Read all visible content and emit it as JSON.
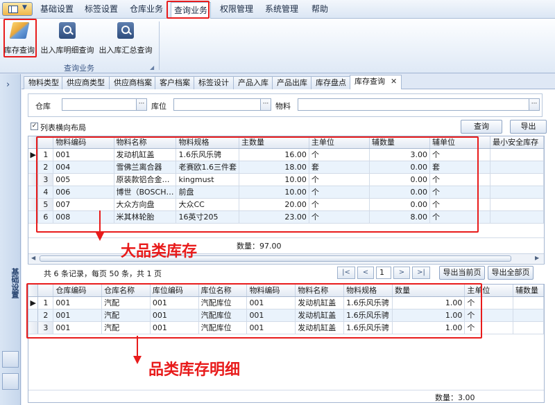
{
  "menu": {
    "items": [
      "基础设置",
      "标签设置",
      "仓库业务",
      "查询业务",
      "权限管理",
      "系统管理",
      "帮助"
    ],
    "active_index": 3
  },
  "ribbon": {
    "buttons": [
      "库存查询",
      "出入库明细查询",
      "出入库汇总查询"
    ],
    "group_label": "查询业务"
  },
  "left_nav": {
    "label": "基础设置"
  },
  "tabs": {
    "items": [
      "物料类型",
      "供应商类型",
      "供应商档案",
      "客户档案",
      "标签设计",
      "产品入库",
      "产品出库",
      "库存盘点",
      "库存查询"
    ],
    "active_index": 8,
    "close_glyph": "✕"
  },
  "filters": {
    "warehouse_label": "仓库",
    "warehouse_value": "",
    "location_label": "库位",
    "location_value": "",
    "material_label": "物料",
    "material_value": "",
    "dots": "···"
  },
  "options": {
    "horizontal_layout_label": "列表横向布局",
    "horizontal_layout_checked": true
  },
  "actions": {
    "query_label": "查询",
    "export_label": "导出"
  },
  "stock_grid": {
    "columns": [
      "物料编码",
      "物料名称",
      "物料规格",
      "主数量",
      "主单位",
      "辅数量",
      "辅单位",
      "最小安全库存"
    ],
    "rows": [
      [
        "1",
        "001",
        "发动机缸盖",
        "1.6乐风乐骋",
        "16.00",
        "个",
        "3.00",
        "个",
        ""
      ],
      [
        "2",
        "004",
        "雪佛兰离合器",
        "老赛欧1.6三件套",
        "18.00",
        "套",
        "0.00",
        "套",
        ""
      ],
      [
        "3",
        "005",
        "原装款铝合金…",
        "kingmust",
        "10.00",
        "个",
        "0.00",
        "个",
        ""
      ],
      [
        "4",
        "006",
        "博世（BOSCH…",
        "前盘",
        "10.00",
        "个",
        "0.00",
        "个",
        ""
      ],
      [
        "5",
        "007",
        "大众方向盘",
        "大众CC",
        "20.00",
        "个",
        "0.00",
        "个",
        ""
      ],
      [
        "6",
        "008",
        "米其林轮胎",
        "16英寸205",
        "23.00",
        "个",
        "8.00",
        "个",
        ""
      ]
    ],
    "summary_label": "数量：97.00",
    "row_indicator": "▶"
  },
  "pager": {
    "info": "共 6 条记录，每页 50 条，共 1 页",
    "first": "|<",
    "prev": "<",
    "page": "1",
    "next": ">",
    "last": ">|",
    "export_current": "导出当前页",
    "export_all": "导出全部页"
  },
  "detail_grid": {
    "columns": [
      "仓库编码",
      "仓库名称",
      "库位编码",
      "库位名称",
      "物料编码",
      "物料名称",
      "物料规格",
      "数量",
      "主单位",
      "辅数量"
    ],
    "rows": [
      [
        "1",
        "001",
        "汽配",
        "001",
        "汽配库位",
        "001",
        "发动机缸盖",
        "1.6乐风乐骋",
        "1.00",
        "个",
        ""
      ],
      [
        "2",
        "001",
        "汽配",
        "001",
        "汽配库位",
        "001",
        "发动机缸盖",
        "1.6乐风乐骋",
        "1.00",
        "个",
        ""
      ],
      [
        "3",
        "001",
        "汽配",
        "001",
        "汽配库位",
        "001",
        "发动机缸盖",
        "1.6乐风乐骋",
        "1.00",
        "个",
        ""
      ]
    ],
    "summary_label": "数量：3.00",
    "row_indicator": "▶"
  },
  "annotations": {
    "big_category": "大品类库存",
    "category_detail": "品类库存明细"
  },
  "colors": {
    "highlight_red": "#e81b1b",
    "ribbon_blue": "#dfe8f5",
    "alt_row": "#eaf3fc"
  }
}
